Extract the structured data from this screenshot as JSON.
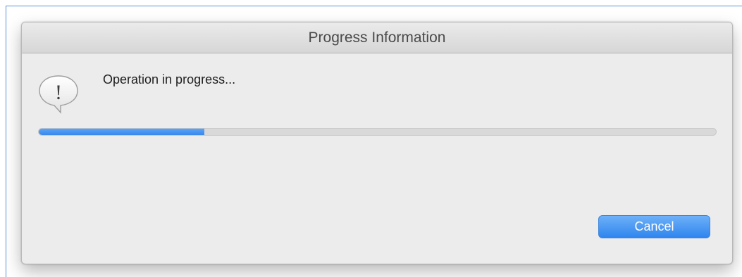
{
  "dialog": {
    "title": "Progress Information",
    "message": "Operation in progress...",
    "icon": "information-alert-icon",
    "progress_fraction": 0.245,
    "cancel_label": "Cancel"
  },
  "colors": {
    "progress_fill": "#3a87ec",
    "button_accent": "#2f85ee"
  }
}
